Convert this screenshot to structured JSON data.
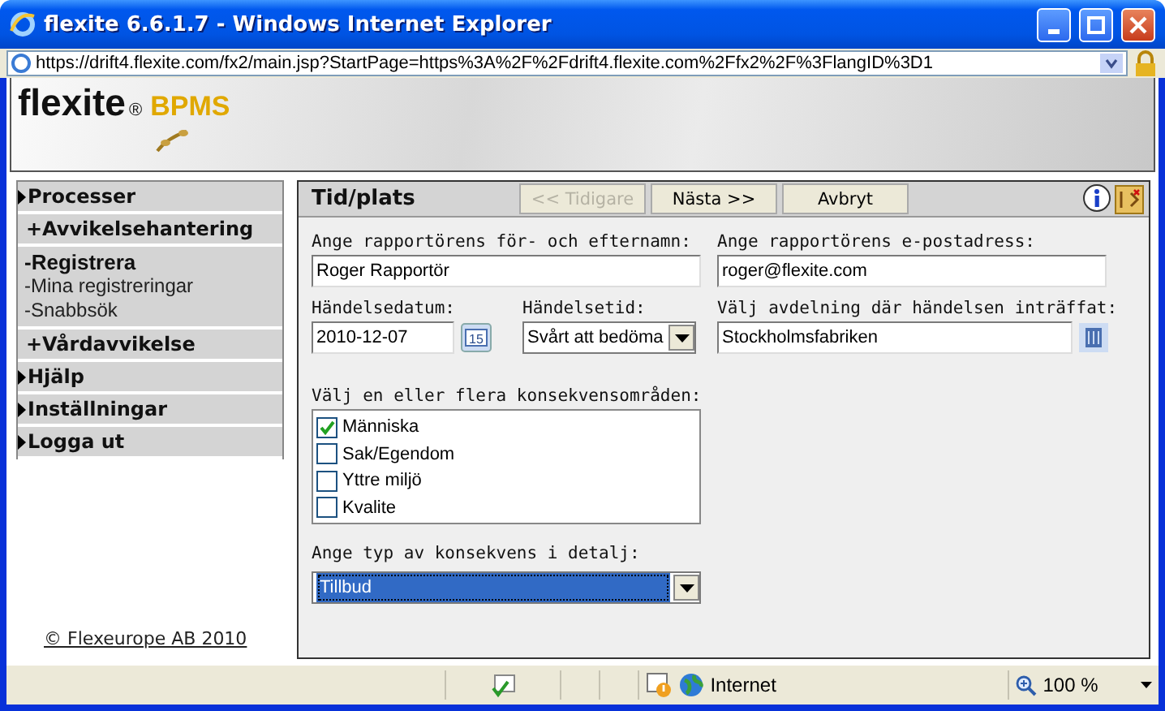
{
  "window": {
    "title": "flexite 6.6.1.7 - Windows Internet Explorer"
  },
  "address_bar": {
    "url": "https://drift4.flexite.com/fx2/main.jsp?StartPage=https%3A%2F%2Fdrift4.flexite.com%2Ffx2%2F%3FlangID%3D1"
  },
  "logo": {
    "name": "flexite",
    "mark": "®",
    "product": "BPMS"
  },
  "sidebar": {
    "items": [
      {
        "kind": "section",
        "label": "Processer"
      },
      {
        "kind": "group",
        "label": "+Avvikelsehantering",
        "children": [
          {
            "label": "-Registrera",
            "selected": true
          },
          {
            "label": "-Mina registreringar",
            "selected": false
          },
          {
            "label": "-Snabbsök",
            "selected": false
          }
        ]
      },
      {
        "kind": "group",
        "label": "+Vårdavvikelse"
      },
      {
        "kind": "section",
        "label": "Hjälp"
      },
      {
        "kind": "section",
        "label": "Inställningar"
      },
      {
        "kind": "section",
        "label": "Logga ut"
      }
    ],
    "footer": "© Flexeurope AB 2010"
  },
  "panel": {
    "title": "Tid/plats",
    "buttons": [
      {
        "label": "<< Tidigare",
        "disabled": true
      },
      {
        "label": "Nästa >>",
        "disabled": false
      },
      {
        "label": "Avbryt",
        "disabled": false
      }
    ],
    "reporter_name": {
      "label": "Ange rapportörens för- och efternamn:",
      "value": "Roger Rapportör"
    },
    "reporter_email": {
      "label": "Ange rapportörens e-postadress:",
      "value": "roger@flexite.com"
    },
    "event_date": {
      "label": "Händelsedatum:",
      "value": "2010-12-07",
      "calendar_day": "15"
    },
    "event_time": {
      "label": "Händelsetid:",
      "value": "Svårt att bedöma"
    },
    "department": {
      "label": "Välj avdelning där händelsen inträffat:",
      "value": "Stockholmsfabriken"
    },
    "consequence_areas": {
      "label": "Välj en eller flera konsekvensområden:",
      "options": [
        {
          "label": "Människa",
          "checked": true
        },
        {
          "label": "Sak/Egendom",
          "checked": false
        },
        {
          "label": "Yttre miljö",
          "checked": false
        },
        {
          "label": "Kvalite",
          "checked": false
        }
      ]
    },
    "consequence_type": {
      "label": "Ange typ av konsekvens i detalj:",
      "value": "Tillbud",
      "focused": true
    }
  },
  "status_bar": {
    "zone": "Internet",
    "zoom": "100 %"
  }
}
